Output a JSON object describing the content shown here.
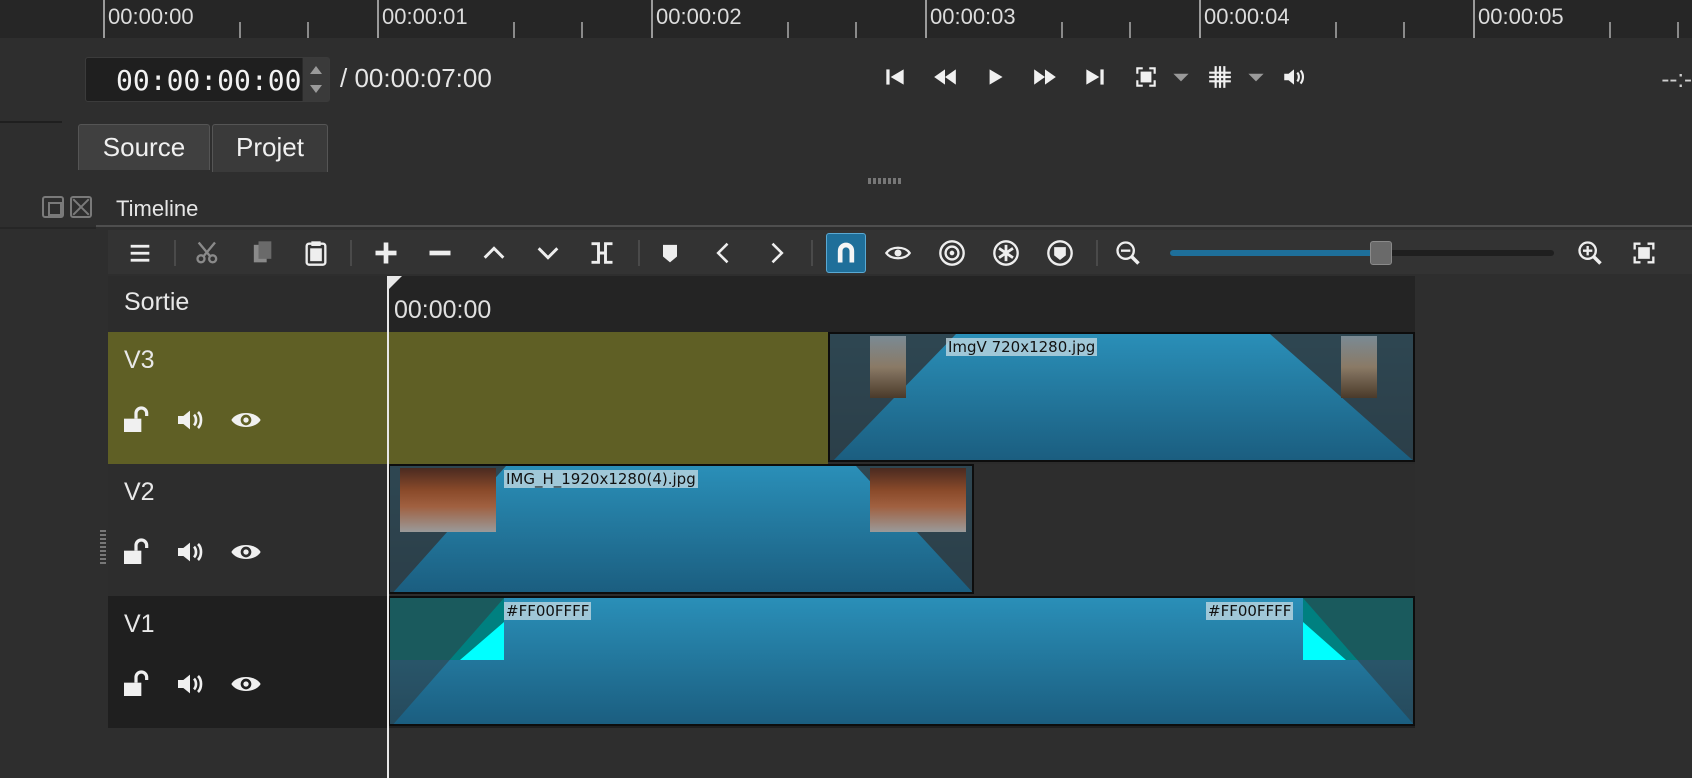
{
  "ruler": {
    "labels": [
      "00:00:00",
      "00:00:01",
      "00:00:02",
      "00:00:03",
      "00:00:04",
      "00:00:05"
    ]
  },
  "transport": {
    "position": "00:00:00:00",
    "duration": "/ 00:00:07:00",
    "right_timecode": "--:-"
  },
  "tabs": {
    "source": "Source",
    "project": "Projet"
  },
  "dock": {
    "title": "Timeline"
  },
  "timeline": {
    "output_label": "Sortie",
    "ruler_time": "00:00:00",
    "zoom_level": 0.55,
    "tracks": [
      {
        "name": "V3",
        "color": "#5f5f25"
      },
      {
        "name": "V2",
        "color": "#2d2d2d"
      },
      {
        "name": "V1",
        "color": "#1f1f1f"
      }
    ],
    "clips": {
      "v3": "ImgV 720x1280.jpg",
      "v2": "IMG_H_1920x1280(4).jpg",
      "v1_start": "#FF00FFFF",
      "v1_end": "#FF00FFFF"
    }
  },
  "colors": {
    "accent": "#1f6f9a",
    "clip_top": "#2a8fb8",
    "clip_bottom": "#1b5e80",
    "v1_color_area": "#008080",
    "cyan_fade": "#00ffff"
  },
  "icons": {
    "toolbar": [
      "menu-icon",
      "cut-icon",
      "copy-icon",
      "paste-icon",
      "append-icon",
      "remove-icon",
      "lift-icon",
      "overwrite-icon",
      "split-icon",
      "marker-icon",
      "previous-marker-icon",
      "next-marker-icon",
      "snap-icon",
      "scrub-icon",
      "ripple-icon",
      "ripple-all-icon",
      "ripple-markers-icon",
      "zoom-out-icon",
      "zoom-in-icon",
      "zoom-fit-icon"
    ],
    "transport": [
      "skip-start-icon",
      "rewind-icon",
      "play-icon",
      "fast-forward-icon",
      "skip-end-icon",
      "fit-view-icon",
      "grid-icon",
      "volume-icon"
    ]
  }
}
